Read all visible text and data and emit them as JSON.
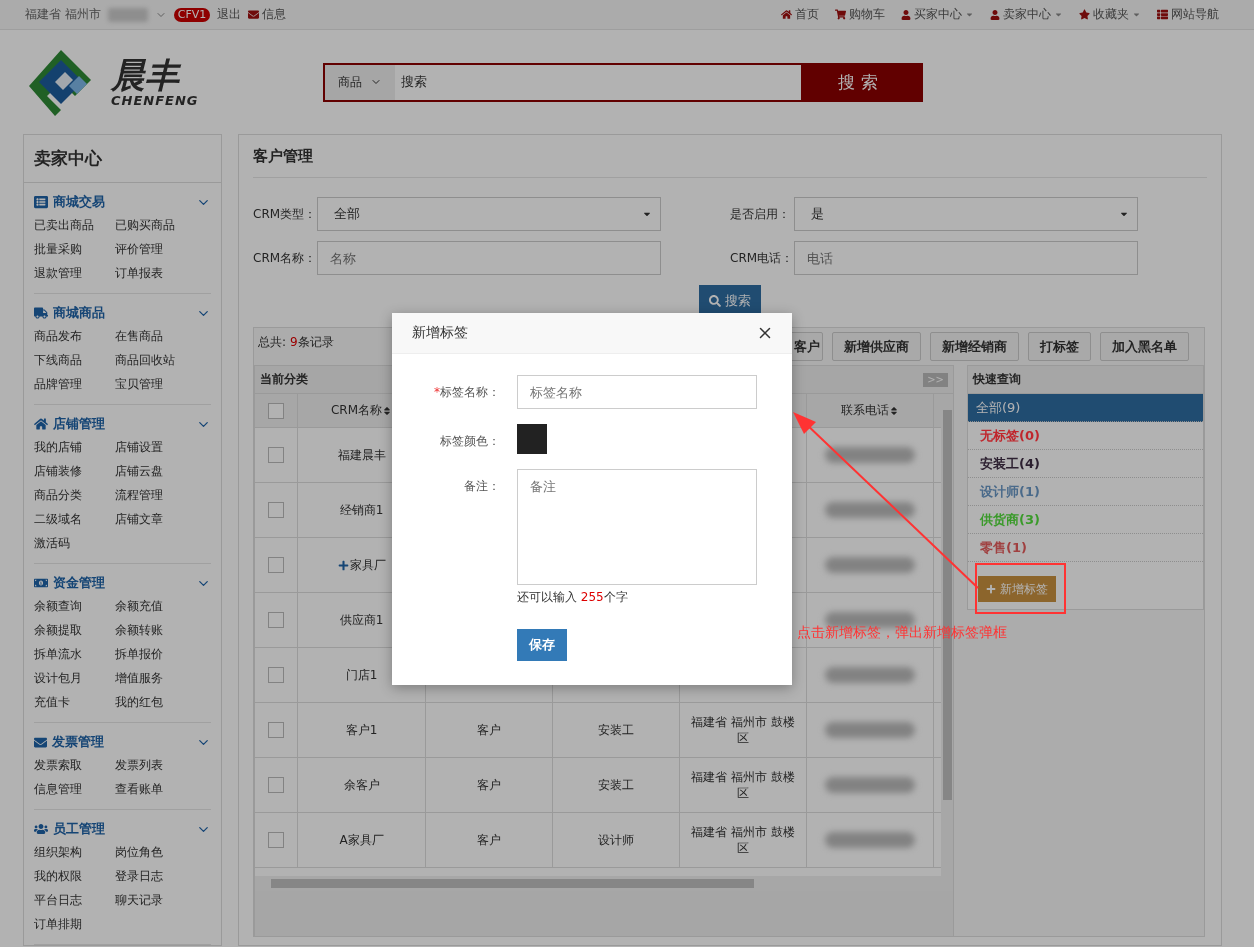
{
  "top_bar": {
    "location": "福建省 福州市",
    "badge": "CFV1",
    "logout": "退出",
    "messages": "信息",
    "links": [
      {
        "label": "首页",
        "kind": "home",
        "dropdown": false
      },
      {
        "label": "购物车",
        "kind": "cart",
        "dropdown": false
      },
      {
        "label": "买家中心",
        "kind": "user",
        "dropdown": true
      },
      {
        "label": "卖家中心",
        "kind": "user",
        "dropdown": true
      },
      {
        "label": "收藏夹",
        "kind": "star",
        "dropdown": true
      },
      {
        "label": "网站导航",
        "kind": "list",
        "dropdown": false
      }
    ]
  },
  "logo": {
    "name": "晨丰",
    "latin": "CHENFENG"
  },
  "search": {
    "category": "商品",
    "value": "搜索",
    "button": "搜索"
  },
  "sidebar": {
    "title": "卖家中心",
    "sections": [
      {
        "title": "商城交易",
        "kind": "list",
        "expanded": true,
        "items": [
          "已卖出商品",
          "已购买商品",
          "批量采购",
          "评价管理",
          "退款管理",
          "订单报表"
        ]
      },
      {
        "title": "商城商品",
        "kind": "truck",
        "expanded": true,
        "items": [
          "商品发布",
          "在售商品",
          "下线商品",
          "商品回收站",
          "品牌管理",
          "宝贝管理"
        ]
      },
      {
        "title": "店铺管理",
        "kind": "home",
        "expanded": true,
        "items": [
          "我的店铺",
          "店铺设置",
          "店铺装修",
          "店铺云盘",
          "商品分类",
          "流程管理",
          "二级域名",
          "店铺文章",
          "激活码"
        ]
      },
      {
        "title": "资金管理",
        "kind": "money",
        "expanded": true,
        "items": [
          "余额查询",
          "余额充值",
          "余额提取",
          "余额转账",
          "拆单流水",
          "拆单报价",
          "设计包月",
          "增值服务",
          "充值卡",
          "我的红包"
        ]
      },
      {
        "title": "发票管理",
        "kind": "envelope",
        "expanded": true,
        "items": [
          "发票索取",
          "发票列表",
          "信息管理",
          "查看账单"
        ]
      },
      {
        "title": "员工管理",
        "kind": "users",
        "expanded": true,
        "items": [
          "组织架构",
          "岗位角色",
          "我的权限",
          "登录日志",
          "平台日志",
          "聊天记录",
          "订单排期"
        ]
      }
    ]
  },
  "page": {
    "title": "客户管理",
    "filters": [
      {
        "label": "CRM类型：",
        "kind": "select",
        "value": "全部"
      },
      {
        "label": "是否启用：",
        "kind": "select",
        "value": "是"
      },
      {
        "label": "CRM名称：",
        "kind": "input",
        "placeholder": "名称"
      },
      {
        "label": "CRM电话：",
        "kind": "input",
        "placeholder": "电话"
      }
    ],
    "search_button": "搜索"
  },
  "toolbar": {
    "total_label": "总共:",
    "total_count": "9",
    "total_unit": "条记录",
    "buttons": [
      "客户",
      "新增供应商",
      "新增经销商",
      "打标签",
      "加入黑名单"
    ]
  },
  "category_bar": {
    "title": "当前分类",
    "toggle": ">>"
  },
  "table": {
    "all_checked": false,
    "header": {
      "name": "CRM名称",
      "phone": "联系电话"
    },
    "rows": [
      {
        "checked": false,
        "expandable": false,
        "name": "福建晨丰"
      },
      {
        "checked": false,
        "expandable": false,
        "name": "经销商1"
      },
      {
        "checked": false,
        "expandable": true,
        "name": "家具厂"
      },
      {
        "checked": false,
        "expandable": false,
        "name": "供应商1"
      },
      {
        "checked": false,
        "expandable": false,
        "name": "门店1"
      },
      {
        "checked": false,
        "expandable": false,
        "name": "客户1",
        "type": "客户",
        "tag": "安装工",
        "region": "福建省 福州市 鼓楼区"
      },
      {
        "checked": false,
        "expandable": false,
        "name": "余客户",
        "type": "客户",
        "tag": "安装工",
        "region": "福建省 福州市 鼓楼区"
      },
      {
        "checked": false,
        "expandable": false,
        "name": "A家具厂",
        "type": "客户",
        "tag": "设计师",
        "region": "福建省 福州市 鼓楼区"
      }
    ]
  },
  "quick_query": {
    "title": "快速查询",
    "items": [
      {
        "label": "全部(9)",
        "selected": true
      },
      {
        "label": "无标签(0)",
        "selected": false,
        "color": "#c0262c"
      },
      {
        "label": "安装工(4)",
        "selected": false,
        "color": "#2c2030"
      },
      {
        "label": "设计师(1)",
        "selected": false,
        "color": "#4a6a8a"
      },
      {
        "label": "供货商(3)",
        "selected": false,
        "color": "#3a9a2a"
      },
      {
        "label": "零售(1)",
        "selected": false,
        "color": "#a04040"
      }
    ],
    "add_button": "新增标签"
  },
  "modal": {
    "title": "新增标签",
    "fields": [
      {
        "kind": "text",
        "label": "标签名称：",
        "required_mark": "*",
        "placeholder": "标签名称"
      },
      {
        "kind": "color",
        "label": "标签颜色：",
        "color": "#222222"
      },
      {
        "kind": "textarea",
        "label": "备注：",
        "placeholder": "备注",
        "counter_prefix": "还可以输入",
        "counter_value": "255",
        "counter_suffix": "个字"
      }
    ],
    "save": "保存"
  },
  "annotation": {
    "text": "点击新增标签，弹出新增标签弹框"
  }
}
